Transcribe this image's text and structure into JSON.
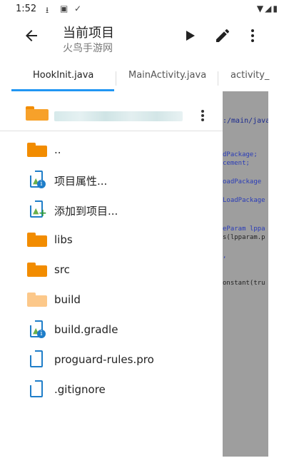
{
  "status_bar": {
    "time": "1:52"
  },
  "app_bar": {
    "title": "当前项目",
    "subtitle": "火鸟手游网"
  },
  "tabs": [
    {
      "label": "HookInit.java",
      "active": true
    },
    {
      "label": "MainActivity.java",
      "active": false
    },
    {
      "label": "activity_",
      "active": false
    }
  ],
  "drawer": {
    "path_dots": "...",
    "items": [
      {
        "label": "..",
        "icon": "folder-orange"
      },
      {
        "label": "项目属性...",
        "icon": "android-info"
      },
      {
        "label": "添加到项目...",
        "icon": "android-add"
      },
      {
        "label": "libs",
        "icon": "folder-orange"
      },
      {
        "label": "src",
        "icon": "folder-orange"
      },
      {
        "label": "build",
        "icon": "folder-light"
      },
      {
        "label": "build.gradle",
        "icon": "android-info"
      },
      {
        "label": "proguard-rules.pro",
        "icon": "file"
      },
      {
        "label": ".gitignore",
        "icon": "file"
      }
    ]
  },
  "editor": {
    "lines": [
      ":/main/java/",
      "dPackage;",
      "cement;",
      "oadPackage",
      "LoadPackage",
      "eParam lppa",
      "s(lpparam.p",
      ",",
      "onstant(tru"
    ]
  },
  "colors": {
    "accent": "#2196f3",
    "folder_orange": "#f28c00",
    "folder_light": "#fcc88a",
    "file_blue": "#1f7ec9"
  }
}
